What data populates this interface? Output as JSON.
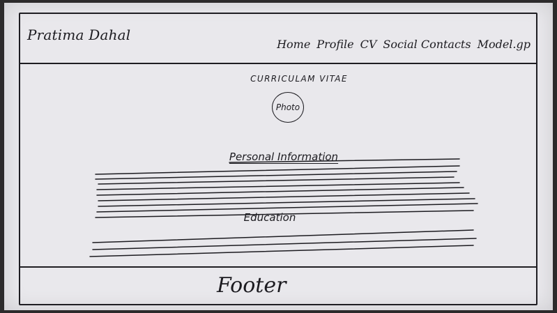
{
  "header": {
    "site_title": "Pratima Dahal",
    "nav": [
      "Home",
      "Profile",
      "CV",
      "Social Contacts",
      "Model.gp"
    ]
  },
  "main": {
    "cv_title": "CURRICULAM VITAE",
    "photo_label": "Photo",
    "personal_info_heading": "Personal Information",
    "education_heading": "Education"
  },
  "footer": {
    "label": "Footer"
  }
}
